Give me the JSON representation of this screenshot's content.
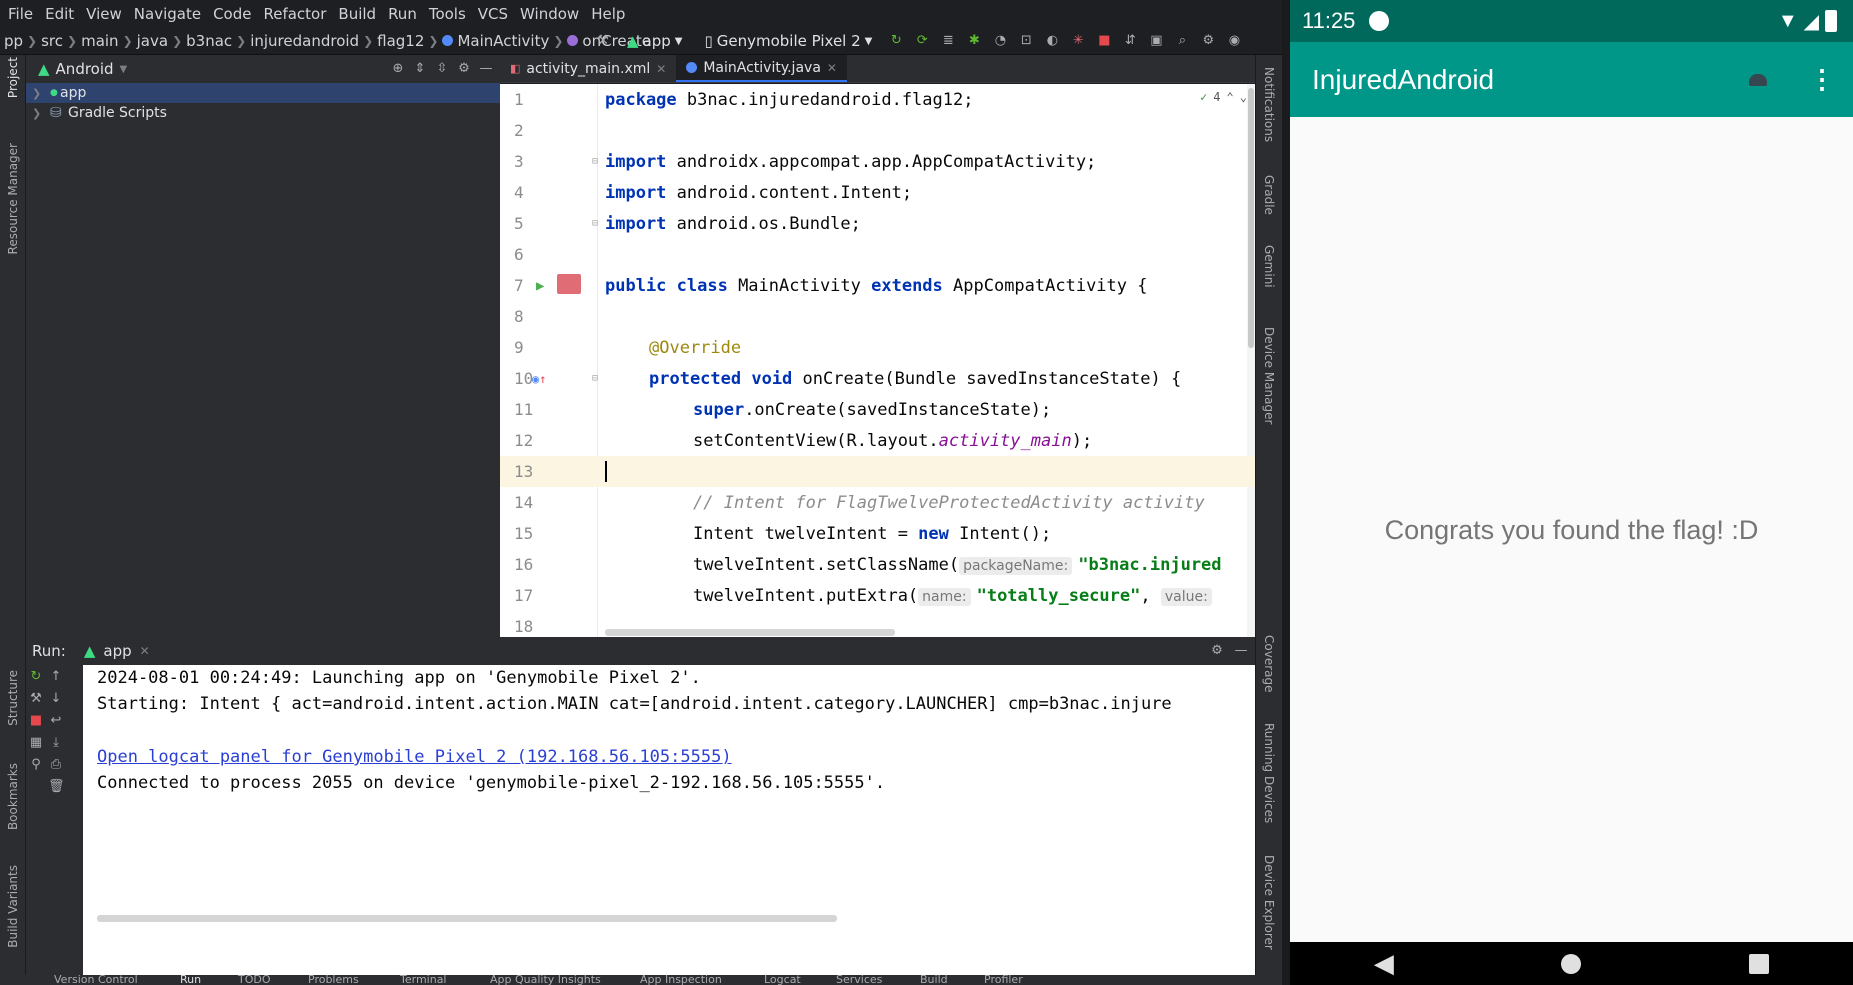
{
  "menu": [
    "File",
    "Edit",
    "View",
    "Navigate",
    "Code",
    "Refactor",
    "Build",
    "Run",
    "Tools",
    "VCS",
    "Window",
    "Help"
  ],
  "breadcrumbs": [
    "pp",
    "src",
    "main",
    "java",
    "b3nac",
    "injuredandroid",
    "flag12",
    "MainActivity",
    "onCreate"
  ],
  "toolbar": {
    "run_config": "app",
    "device": "Genymobile Pixel 2"
  },
  "left_strip": [
    "Project",
    "Resource Manager",
    "Structure",
    "Bookmarks",
    "Build Variants"
  ],
  "right_strip": [
    "Notifications",
    "Gradle",
    "Gemini",
    "Device Manager",
    "Coverage",
    "Running Devices",
    "Device Explorer"
  ],
  "project_panel": {
    "view": "Android",
    "items": [
      "app",
      "Gradle Scripts"
    ]
  },
  "editor": {
    "tabs": [
      "activity_main.xml",
      "MainActivity.java"
    ],
    "active_tab": "MainActivity.java",
    "inspection_count": "4",
    "line_numbers": [
      "1",
      "2",
      "3",
      "4",
      "5",
      "6",
      "7",
      "8",
      "9",
      "10",
      "11",
      "12",
      "13",
      "14",
      "15",
      "16",
      "17",
      "18"
    ],
    "code": {
      "l1_kw": "package",
      "l1_rest": " b3nac.injuredandroid.flag12;",
      "l3_kw": "import",
      "l3_rest": " androidx.appcompat.app.AppCompatActivity;",
      "l4_kw": "import",
      "l4_rest": " android.content.Intent;",
      "l5_kw": "import",
      "l5_rest": " android.os.Bundle;",
      "l7_kw1": "public class",
      "l7_mid": " MainActivity ",
      "l7_kw2": "extends",
      "l7_rest": " AppCompatActivity {",
      "l9_ann": "@Override",
      "l10_kw": "protected void",
      "l10_rest": " onCreate(Bundle savedInstanceState) {",
      "l11_kw": "super",
      "l11_rest": ".onCreate(savedInstanceState);",
      "l12_pre": "setContentView(R.layout.",
      "l12_it": "activity_main",
      "l12_post": ");",
      "l14_comment": "// Intent for FlagTwelveProtectedActivity activity",
      "l15_pre": "Intent twelveIntent = ",
      "l15_kw": "new",
      "l15_post": " Intent();",
      "l16_pre": "twelveIntent.setClassName(",
      "l16_hint": "packageName:",
      "l16_str": "\"b3nac.injured",
      "l17_pre": "twelveIntent.putExtra(",
      "l17_hint1": "name:",
      "l17_str": "\"totally_secure\"",
      "l17_comma": ",",
      "l17_hint2": "value:"
    }
  },
  "run_panel": {
    "label": "Run:",
    "tab": "app",
    "lines": [
      "2024-08-01 00:24:49: Launching app on 'Genymobile Pixel 2'.",
      "Starting: Intent { act=android.intent.action.MAIN cat=[android.intent.category.LAUNCHER] cmp=b3nac.injure",
      "Open logcat panel for Genymobile Pixel 2 (192.168.56.105:5555)",
      "Connected to process 2055 on device 'genymobile-pixel_2-192.168.56.105:5555'."
    ]
  },
  "status_tabs": [
    "Version Control",
    "Run",
    "TODO",
    "Problems",
    "Terminal",
    "App Quality Insights",
    "App Inspection",
    "Logcat",
    "Services",
    "Build",
    "Profiler"
  ],
  "phone": {
    "time": "11:25",
    "app_title": "InjuredAndroid",
    "message": "Congrats you found the flag! :D",
    "colors": {
      "status_bar": "#00695c",
      "app_bar": "#009688"
    }
  }
}
